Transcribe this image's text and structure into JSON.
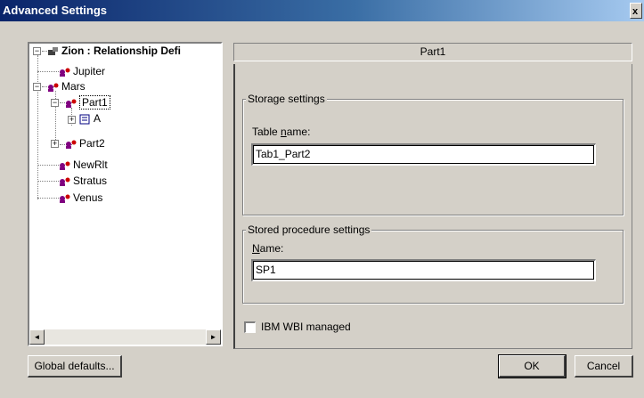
{
  "window": {
    "title": "Advanced Settings",
    "close_label": "x"
  },
  "tree": {
    "root": "Zion : Relationship Defi",
    "items": [
      {
        "label": "Jupiter"
      },
      {
        "label": "Mars"
      },
      {
        "label": "Part1"
      },
      {
        "label": "A"
      },
      {
        "label": "Part2"
      },
      {
        "label": "NewRlt"
      },
      {
        "label": "Stratus"
      },
      {
        "label": "Venus"
      }
    ],
    "expanders": {
      "root": "−",
      "mars": "−",
      "part1": "−",
      "a": "+",
      "part2": "+"
    },
    "scroll_left": "◄",
    "scroll_right": "►"
  },
  "panel": {
    "header": "Part1",
    "storage": {
      "title": "Storage settings",
      "table_label_prefix": "Table ",
      "table_label_underline": "n",
      "table_label_suffix": "ame:",
      "table_value": "Tab1_Part2"
    },
    "procedure": {
      "title": "Stored procedure settings",
      "name_label_prefix": "",
      "name_label_underline": "N",
      "name_label_suffix": "ame:",
      "name_value": "SP1"
    },
    "checkbox_label": "IBM WBI managed"
  },
  "buttons": {
    "global_defaults": "Global defaults...",
    "ok": "OK",
    "cancel": "Cancel"
  },
  "colors": {
    "titlebar_start": "#0a246a",
    "titlebar_end": "#a6caf0",
    "face": "#d4d0c8"
  },
  "icons": {
    "relationship": "relationship-icon",
    "role": "role-icon",
    "attribute": "attribute-icon"
  }
}
